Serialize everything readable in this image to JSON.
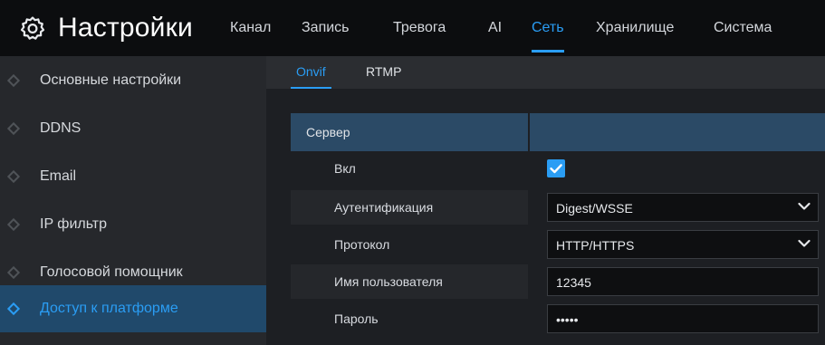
{
  "app": {
    "title": "Настройки"
  },
  "topnav": {
    "tabs": [
      {
        "label": "Канал"
      },
      {
        "label": "Запись"
      },
      {
        "label": "Тревога"
      },
      {
        "label": "AI"
      },
      {
        "label": "Сеть",
        "active": true
      },
      {
        "label": "Хранилище"
      },
      {
        "label": "Система"
      }
    ]
  },
  "sidebar": {
    "items": [
      {
        "label": "Основные настройки"
      },
      {
        "label": "DDNS"
      },
      {
        "label": "Email"
      },
      {
        "label": "IP фильтр"
      },
      {
        "label": "Голосовой помощник"
      },
      {
        "label": "Доступ к платформе",
        "active": true
      }
    ]
  },
  "subtabs": [
    {
      "label": "Onvif",
      "active": true
    },
    {
      "label": "RTMP"
    }
  ],
  "section": {
    "title": "Сервер"
  },
  "form": {
    "enable": {
      "label": "Вкл",
      "checked": true
    },
    "auth": {
      "label": "Аутентификация",
      "value": "Digest/WSSE"
    },
    "protocol": {
      "label": "Протокол",
      "value": "HTTP/HTTPS"
    },
    "username": {
      "label": "Имя пользователя",
      "value": "12345"
    },
    "password": {
      "label": "Пароль",
      "value": "•••••"
    }
  },
  "colors": {
    "accent": "#2a9df4",
    "header_bg": "#0c0d0f",
    "active_sidebar_bg": "#20496b",
    "section_header_bg": "#2b4a66"
  }
}
